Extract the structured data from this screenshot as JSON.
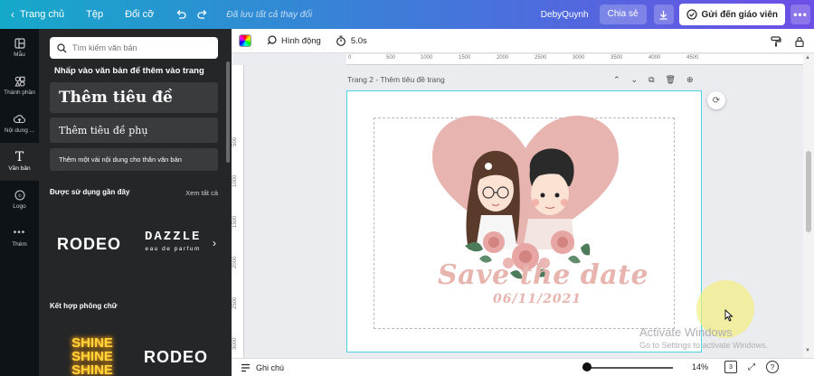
{
  "topbar": {
    "home": "Trang chủ",
    "file": "Tệp",
    "resize": "Đổi cỡ",
    "saved_status": "Đã lưu tất cả thay đổi",
    "user_name": "DebyQuynh",
    "share": "Chia sẻ",
    "send_teacher": "Gửi đến giáo viên"
  },
  "rail": {
    "items": [
      {
        "label": "Mẫu",
        "icon": "template-icon"
      },
      {
        "label": "Thành phần",
        "icon": "elements-icon"
      },
      {
        "label": "Nội dung ...",
        "icon": "upload-icon"
      },
      {
        "label": "Văn bản",
        "icon": "text-icon"
      },
      {
        "label": "Logo",
        "icon": "logo-icon"
      },
      {
        "label": "Thêm",
        "icon": "more-icon"
      }
    ]
  },
  "panel": {
    "search_placeholder": "Tìm kiếm văn bản",
    "hint": "Nhấp vào văn bản để thêm vào trang",
    "add_heading": "Thêm tiêu đề",
    "add_subheading": "Thêm tiêu đề phụ",
    "add_body": "Thêm một vài nội dung cho thân văn bản",
    "recent_title": "Được sử dụng gần đây",
    "see_all": "Xem tất cả",
    "recent_fonts": [
      {
        "main": "RODEO",
        "sub": ""
      },
      {
        "main": "DAZZLE",
        "sub": "eau de parfum"
      }
    ],
    "combo_title": "Kết hợp phông chữ",
    "combo_fonts": [
      {
        "main": "SHINE SHINE SHINE"
      },
      {
        "main": "RODEO"
      }
    ]
  },
  "toolbar2": {
    "animate": "Hình động",
    "duration": "5.0s"
  },
  "rulers": {
    "top": [
      "0",
      "500",
      "1000",
      "1500",
      "2000",
      "2500",
      "3000",
      "3500",
      "4000",
      "4500"
    ],
    "left": [
      "500",
      "1000",
      "1500",
      "2000",
      "2500",
      "3000"
    ]
  },
  "canvas": {
    "page_label": "Trang 2 - Thêm tiêu đề trang",
    "title_text": "Save the date",
    "date_text": "06/11/2021",
    "heart_color": "#e8b4b0"
  },
  "watermark": {
    "line1": "Activate Windows",
    "line2": "Go to Settings to activate Windows."
  },
  "bottom": {
    "notes": "Ghi chú",
    "zoom": "14%",
    "zoom_fraction": 0.05,
    "page_count": "3"
  }
}
